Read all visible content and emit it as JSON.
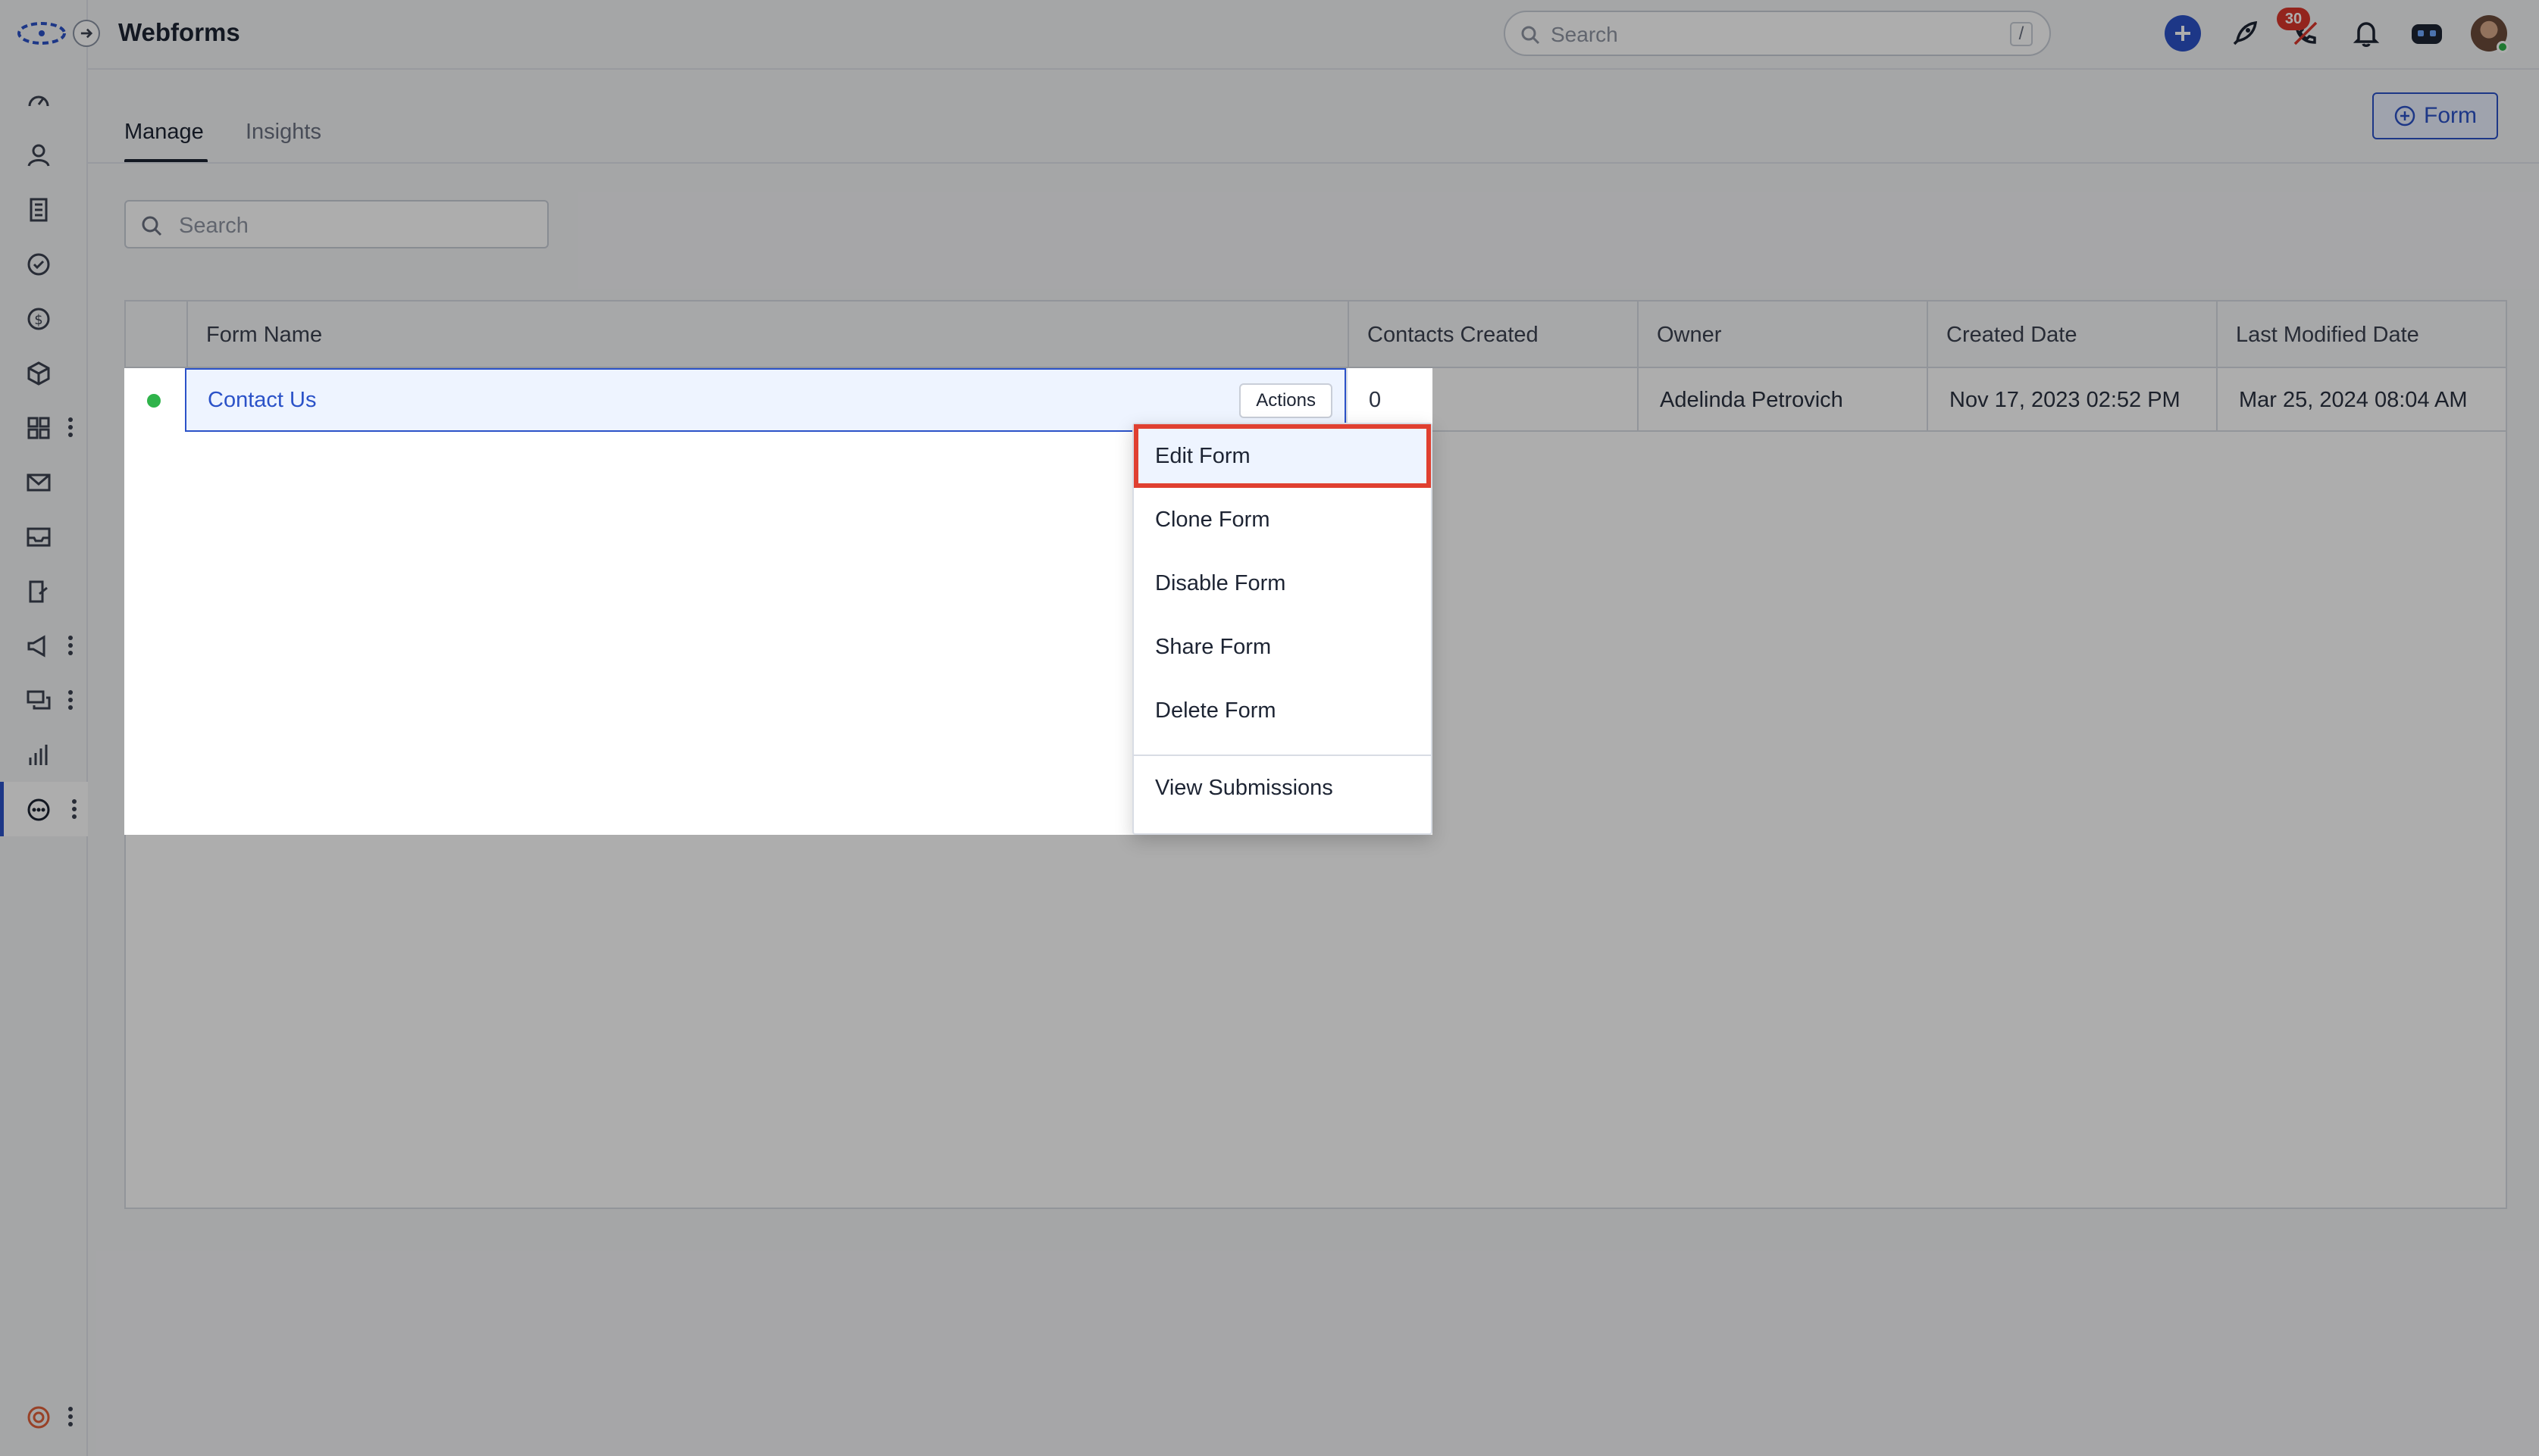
{
  "app": {
    "title": "Webforms"
  },
  "topbar": {
    "search_placeholder": "Search",
    "search_shortcut": "/",
    "notifications_count": "30",
    "icons": [
      "add-icon",
      "rocket-icon",
      "phone-off-icon",
      "bell-icon",
      "bot-icon",
      "avatar"
    ]
  },
  "rail": {
    "items": [
      "dashboard-icon",
      "contacts-icon",
      "accounts-icon",
      "tasks-icon",
      "deals-icon",
      "products-icon",
      "apps-icon",
      "email-icon",
      "inbox-icon",
      "sequences-icon",
      "campaigns-icon",
      "chat-icon",
      "reports-icon",
      "more-icon"
    ],
    "active": "more-icon",
    "footer_icon": "help-icon"
  },
  "tabs": [
    {
      "label": "Manage",
      "active": true
    },
    {
      "label": "Insights",
      "active": false
    }
  ],
  "add_button_label": "Form",
  "list_search_placeholder": "Search",
  "table": {
    "columns": [
      "Form Name",
      "Contacts Created",
      "Owner",
      "Created Date",
      "Last Modified Date"
    ],
    "rows": [
      {
        "status": "active",
        "form_name": "Contact Us",
        "actions_label": "Actions",
        "contacts_created": "0",
        "owner": "Adelinda Petrovich",
        "created_date": "Nov 17, 2023 02:52 PM",
        "last_modified_date": "Mar 25, 2024 08:04 AM"
      }
    ]
  },
  "actions_menu": {
    "items": [
      "Edit Form",
      "Clone Form",
      "Disable Form",
      "Share Form",
      "Delete Form"
    ],
    "footer_item": "View Submissions",
    "highlighted": "Edit Form"
  },
  "colors": {
    "accent": "#2b52c8",
    "highlight_border": "#e04030",
    "status_active": "#2fb34a",
    "badge": "#d9362b"
  }
}
